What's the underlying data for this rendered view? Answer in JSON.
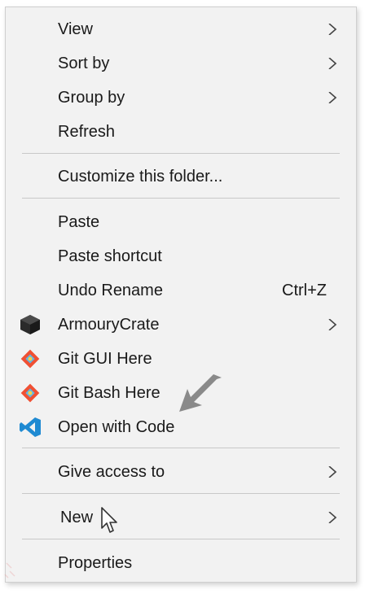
{
  "menu": {
    "items": [
      {
        "label": "View",
        "has_submenu": true
      },
      {
        "label": "Sort by",
        "has_submenu": true
      },
      {
        "label": "Group by",
        "has_submenu": true
      },
      {
        "label": "Refresh"
      },
      {
        "label": "Customize this folder..."
      },
      {
        "label": "Paste"
      },
      {
        "label": "Paste shortcut"
      },
      {
        "label": "Undo Rename",
        "shortcut": "Ctrl+Z"
      },
      {
        "label": "ArmouryCrate",
        "icon": "armoury-crate-icon",
        "has_submenu": true
      },
      {
        "label": "Git GUI Here",
        "icon": "git-icon"
      },
      {
        "label": "Git Bash Here",
        "icon": "git-icon"
      },
      {
        "label": "Open with Code",
        "icon": "vscode-icon"
      },
      {
        "label": "Give access to",
        "has_submenu": true
      },
      {
        "label": "New",
        "has_submenu": true
      },
      {
        "label": "Properties"
      }
    ]
  },
  "colors": {
    "menu_background": "#f2f2f2",
    "separator": "#c8c8c8",
    "text": "#1a1a1a",
    "vscode_blue": "#1f8ad2",
    "git_orange": "#f05033"
  },
  "icons": [
    "chevron-right-icon",
    "armoury-crate-icon",
    "git-icon",
    "vscode-icon",
    "pointer-arrow-icon",
    "mouse-cursor-icon"
  ]
}
